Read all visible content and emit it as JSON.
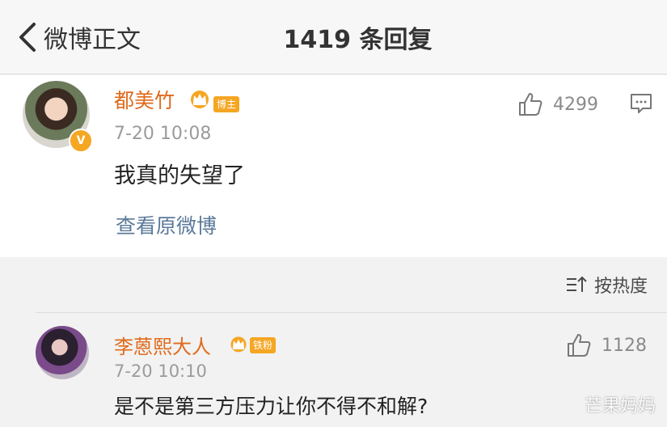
{
  "header": {
    "back_label": "微博正文",
    "title": "1419 条回复"
  },
  "post": {
    "username": "都美竹",
    "tag": "博主",
    "timestamp": "7-20 10:08",
    "text": "我真的失望了",
    "view_original": "查看原微博",
    "likes": "4299",
    "verified_badge": "V"
  },
  "sort": {
    "label": "按热度"
  },
  "reply": {
    "username": "李蒽熙大人",
    "tag": "铁粉",
    "timestamp": "7-20 10:10",
    "text": "是不是第三方压力让你不得不和解?",
    "likes": "1128"
  },
  "watermark": "芒果妈妈",
  "colors": {
    "username": "#e06a1b",
    "link": "#5b7a9a",
    "tag_bg": "#f5a623"
  },
  "icons": [
    "back-chevron-icon",
    "crown-icon",
    "verified-badge-icon",
    "thumbs-up-icon",
    "comment-icon",
    "sort-icon"
  ]
}
